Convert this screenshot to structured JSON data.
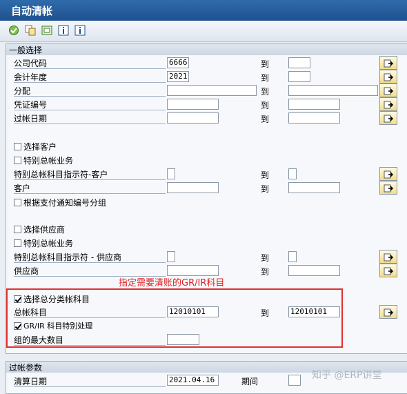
{
  "window": {
    "title": "自动清帐"
  },
  "toolbar": {
    "icons": [
      "execute-icon",
      "copy-icon",
      "save-variant-icon",
      "info-icon",
      "info-icon"
    ]
  },
  "general": {
    "title": "一般选择",
    "company_code": {
      "label": "公司代码",
      "from": "6666",
      "to": ""
    },
    "fiscal_year": {
      "label": "会计年度",
      "from": "2021",
      "to": ""
    },
    "assignment": {
      "label": "分配",
      "from": "",
      "to": ""
    },
    "doc_number": {
      "label": "凭证编号",
      "from": "",
      "to": ""
    },
    "posting_date": {
      "label": "过帐日期",
      "from": "",
      "to": ""
    },
    "select_customers": {
      "label": "选择客户",
      "checked": false
    },
    "special_gl_cust_check": {
      "label": "特别总帐业务",
      "checked": false
    },
    "special_gl_cust": {
      "label": "特别总帐科目指示符-客户",
      "from": "",
      "to": ""
    },
    "customer": {
      "label": "客户",
      "from": "",
      "to": ""
    },
    "group_by_payment": {
      "label": "根据支付通知编号分组",
      "checked": false
    },
    "select_vendors": {
      "label": "选择供应商",
      "checked": false
    },
    "special_gl_vend_check": {
      "label": "特别总帐业务",
      "checked": false
    },
    "special_gl_vend": {
      "label": "特别总帐科目指示符 - 供应商",
      "from": "",
      "to": ""
    },
    "vendor": {
      "label": "供应商",
      "from": "",
      "to": ""
    },
    "select_gl": {
      "label": "选择总分类帐科目",
      "checked": true
    },
    "gl_account": {
      "label": "总帐科目",
      "from": "12010101",
      "to": "12010101"
    },
    "grir_special": {
      "label": "GR/IR 科目特别处理",
      "checked": true
    },
    "max_groups": {
      "label": "组的最大数目",
      "value": ""
    },
    "to_label": "到"
  },
  "annotation": "指定需要清账的GR/IR科目",
  "posting": {
    "title": "过帐参数",
    "clearing_date": {
      "label": "清算日期",
      "value": "2021.04.16"
    },
    "period": {
      "label": "期间",
      "value": ""
    }
  },
  "watermark": "知乎 @ERP讲堂"
}
